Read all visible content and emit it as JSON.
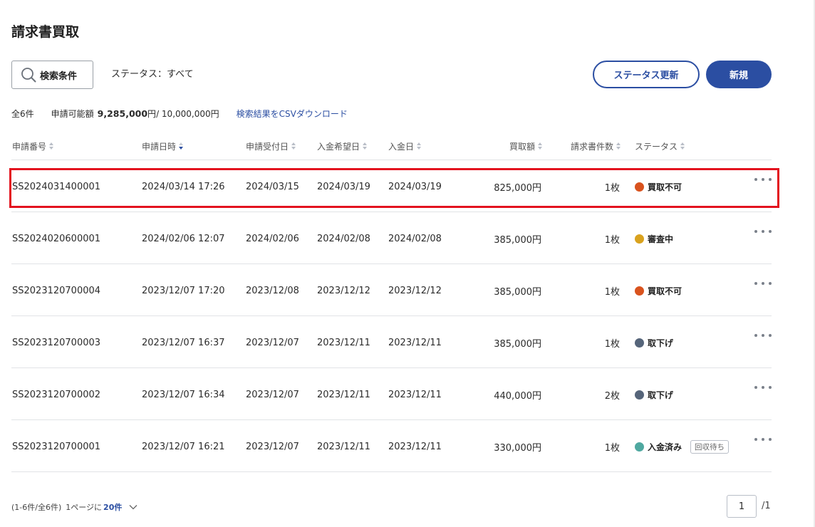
{
  "page": {
    "title": "請求書買取"
  },
  "toolbar": {
    "search_label": "検索条件",
    "status_filter": "ステータス：すべて",
    "status_update_label": "ステータス更新",
    "new_label": "新規"
  },
  "summary": {
    "total": "全6件",
    "available_label": "申請可能額",
    "available_amount": "9,285,000",
    "available_unit": "円",
    "limit": " / 10,000,000円",
    "csv_link": "検索結果をCSVダウンロード"
  },
  "table": {
    "headers": {
      "app_no": "申請番号",
      "app_datetime": "申請日時",
      "received_date": "申請受付日",
      "desired_date": "入金希望日",
      "payment_date": "入金日",
      "amount": "買取額",
      "invoice_count": "請求書件数",
      "status": "ステータス"
    },
    "sorted_column": "app_datetime",
    "rows": [
      {
        "app_no": "SS2024031400001",
        "app_datetime": "2024/03/14 17:26",
        "received_date": "2024/03/15",
        "desired_date": "2024/03/19",
        "payment_date": "2024/03/19",
        "amount": "825,000円",
        "invoice_count": "1枚",
        "status": "買取不可",
        "status_color": "#d9531e",
        "sub_badge": ""
      },
      {
        "app_no": "SS2024020600001",
        "app_datetime": "2024/02/06 12:07",
        "received_date": "2024/02/06",
        "desired_date": "2024/02/08",
        "payment_date": "2024/02/08",
        "amount": "385,000円",
        "invoice_count": "1枚",
        "status": "審査中",
        "status_color": "#d9a21e",
        "sub_badge": ""
      },
      {
        "app_no": "SS2023120700004",
        "app_datetime": "2023/12/07 17:20",
        "received_date": "2023/12/08",
        "desired_date": "2023/12/12",
        "payment_date": "2023/12/12",
        "amount": "385,000円",
        "invoice_count": "1枚",
        "status": "買取不可",
        "status_color": "#d9531e",
        "sub_badge": ""
      },
      {
        "app_no": "SS2023120700003",
        "app_datetime": "2023/12/07 16:37",
        "received_date": "2023/12/07",
        "desired_date": "2023/12/11",
        "payment_date": "2023/12/11",
        "amount": "385,000円",
        "invoice_count": "1枚",
        "status": "取下げ",
        "status_color": "#56657a",
        "sub_badge": ""
      },
      {
        "app_no": "SS2023120700002",
        "app_datetime": "2023/12/07 16:34",
        "received_date": "2023/12/07",
        "desired_date": "2023/12/11",
        "payment_date": "2023/12/11",
        "amount": "440,000円",
        "invoice_count": "2枚",
        "status": "取下げ",
        "status_color": "#56657a",
        "sub_badge": ""
      },
      {
        "app_no": "SS2023120700001",
        "app_datetime": "2023/12/07 16:21",
        "received_date": "2023/12/07",
        "desired_date": "2023/12/11",
        "payment_date": "2023/12/11",
        "amount": "330,000円",
        "invoice_count": "1枚",
        "status": "入金済み",
        "status_color": "#4fa8a0",
        "sub_badge": "回収待ち"
      }
    ]
  },
  "pager": {
    "range": "(1-6件/全6件)",
    "per_page_label": "1ページに",
    "per_page_value": "20件",
    "current_page": "1",
    "total_pages": "/1"
  },
  "colors": {
    "accent": "#2b4ea2",
    "highlight": "#e3131f"
  }
}
